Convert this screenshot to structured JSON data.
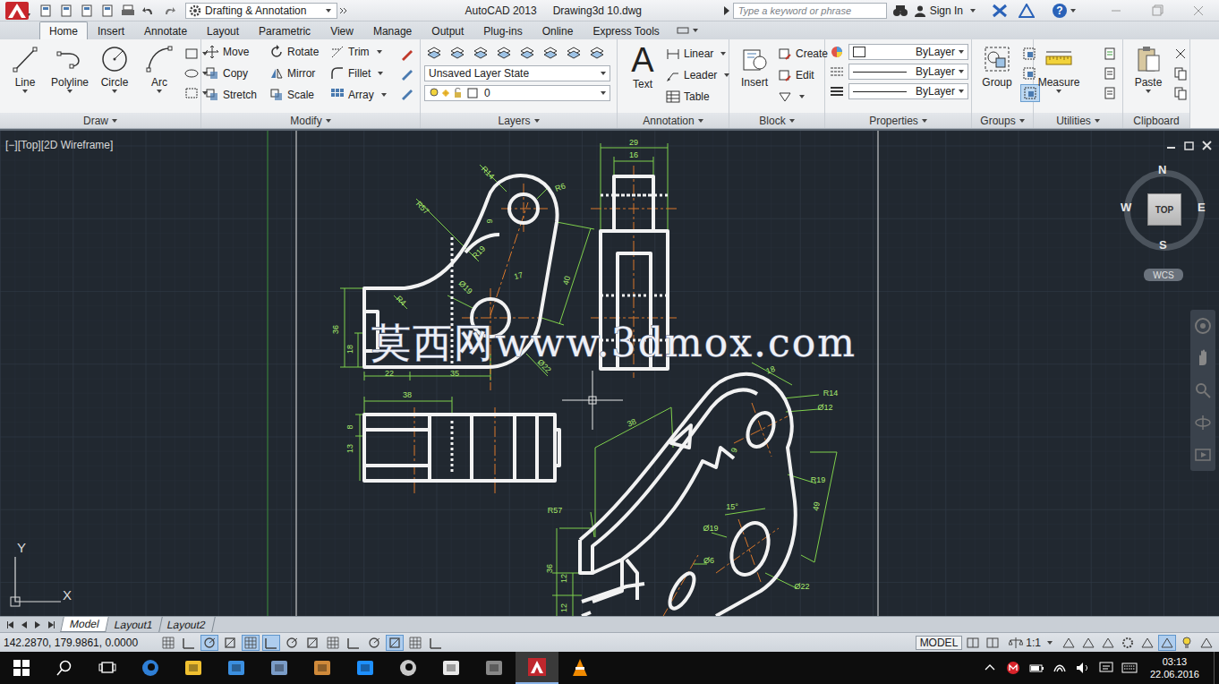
{
  "title_bar": {
    "workspace": "Drafting & Annotation",
    "app_name": "AutoCAD 2013",
    "file_name": "Drawing3d 10.dwg",
    "search_placeholder": "Type a keyword or phrase",
    "sign_in": "Sign In",
    "help": "?"
  },
  "ribbon_tabs": [
    {
      "label": "Home",
      "selected": true
    },
    {
      "label": "Insert",
      "selected": false
    },
    {
      "label": "Annotate",
      "selected": false
    },
    {
      "label": "Layout",
      "selected": false
    },
    {
      "label": "Parametric",
      "selected": false
    },
    {
      "label": "View",
      "selected": false
    },
    {
      "label": "Manage",
      "selected": false
    },
    {
      "label": "Output",
      "selected": false
    },
    {
      "label": "Plug-ins",
      "selected": false
    },
    {
      "label": "Online",
      "selected": false
    },
    {
      "label": "Express Tools",
      "selected": false
    }
  ],
  "draw_panel": {
    "title": "Draw",
    "tools": [
      "Line",
      "Polyline",
      "Circle",
      "Arc"
    ]
  },
  "modify_panel": {
    "title": "Modify",
    "tools": [
      {
        "label": "Move",
        "dropdown": false
      },
      {
        "label": "Rotate",
        "dropdown": false
      },
      {
        "label": "Trim",
        "dropdown": true
      },
      {
        "label": "Copy",
        "dropdown": false
      },
      {
        "label": "Mirror",
        "dropdown": false
      },
      {
        "label": "Fillet",
        "dropdown": true
      },
      {
        "label": "Stretch",
        "dropdown": false
      },
      {
        "label": "Scale",
        "dropdown": false
      },
      {
        "label": "Array",
        "dropdown": true
      }
    ]
  },
  "layers_panel": {
    "title": "Layers",
    "layer_state": "Unsaved Layer State",
    "current_layer": "0"
  },
  "annotation_panel": {
    "title": "Annotation",
    "text_icon": "A",
    "big_tool": "Text",
    "tools": [
      "Linear",
      "Leader",
      "Table"
    ]
  },
  "block_panel": {
    "title": "Block",
    "big_tool": "Insert",
    "tools": [
      "Create",
      "Edit"
    ]
  },
  "properties_panel": {
    "title": "Properties",
    "rows": [
      "ByLayer",
      "ByLayer",
      "ByLayer"
    ]
  },
  "groups_panel": {
    "title": "Groups",
    "big_tool": "Group"
  },
  "utilities_panel": {
    "title": "Utilities",
    "big_tool": "Measure"
  },
  "clipboard_panel": {
    "title": "Clipboard",
    "big_tool": "Paste"
  },
  "viewport": {
    "label": "[−][Top][2D Wireframe]",
    "watermark": "莫西网www.3dmox.com",
    "dimensions": [
      "R14",
      "R6",
      "R57",
      "9",
      "R19",
      "17",
      "40",
      "Ø19",
      "R4",
      "36",
      "18",
      "22",
      "35",
      "Ø22",
      "29",
      "16",
      "38",
      "8",
      "13",
      "18",
      "R14",
      "Ø12",
      "38",
      "9",
      "R19",
      "49",
      "R57",
      "15°",
      "Ø19",
      "Ø6",
      "36",
      "12",
      "12",
      "Ø22"
    ],
    "view_cube": {
      "face": "TOP",
      "north": "N",
      "south": "S",
      "east": "E",
      "west": "W",
      "ucs": "WCS"
    },
    "ucs_icon": {
      "x": "X",
      "y": "Y"
    }
  },
  "layout_tabs": [
    {
      "label": "Model",
      "selected": true
    },
    {
      "label": "Layout1",
      "selected": false
    },
    {
      "label": "Layout2",
      "selected": false
    }
  ],
  "status_bar": {
    "coordinates": "142.2870, 179.9861, 0.0000",
    "toggles": [
      {
        "on": false
      },
      {
        "on": false
      },
      {
        "on": true
      },
      {
        "on": false
      },
      {
        "on": true
      },
      {
        "on": true
      },
      {
        "on": false
      },
      {
        "on": false
      },
      {
        "on": false
      },
      {
        "on": false
      },
      {
        "on": false
      },
      {
        "on": true
      },
      {
        "on": false
      },
      {
        "on": false
      }
    ],
    "space": "MODEL",
    "scale": "1:1"
  },
  "taskbar": {
    "apps": [
      {
        "active": false
      },
      {
        "active": false
      },
      {
        "active": false
      },
      {
        "active": false
      },
      {
        "active": false
      },
      {
        "active": false
      },
      {
        "active": false
      },
      {
        "active": false
      },
      {
        "active": false
      },
      {
        "active": true
      },
      {
        "active": false
      }
    ],
    "time": "03:13",
    "date": "22.06.2016"
  }
}
